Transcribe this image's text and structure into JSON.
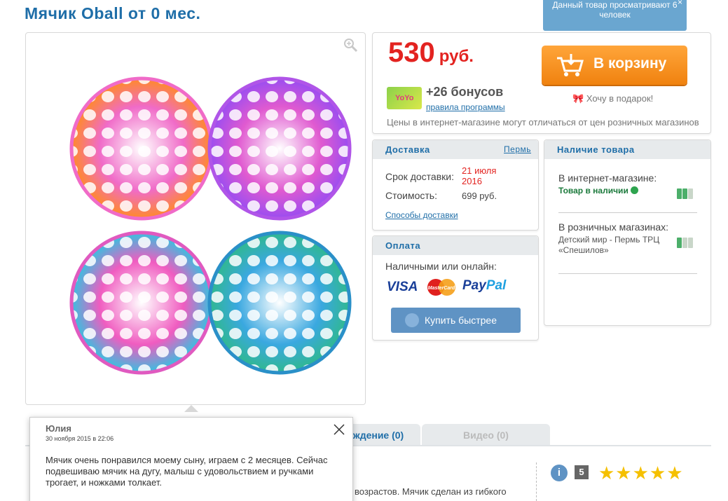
{
  "product": {
    "title": "Мячик Oball от 0 мес.",
    "viewers_text": "Данный товар просматривают 6 человек",
    "viewers_close": "×"
  },
  "price": {
    "value": "530",
    "currency": "руб.",
    "bonus": "+26 бонусов",
    "bonus_card_label": "YoYo",
    "bonus_link": "правила программы",
    "note": "Цены в интернет-магазине могут отличаться от цен розничных магазинов",
    "cart_button": "В корзину",
    "gift": "Хочу в подарок!"
  },
  "delivery": {
    "header": "Доставка",
    "city": "Пермь",
    "term_label": "Срок доставки:",
    "term_value": "21 июля 2016",
    "cost_label": "Стоимость:",
    "cost_value": "699 руб.",
    "methods_link": "Способы доставки"
  },
  "payment": {
    "header": "Оплата",
    "label": "Наличными или онлайн:",
    "visa": "VISA",
    "mastercard": "MasterCard",
    "paypal_a": "Pay",
    "paypal_b": "Pal",
    "quick_button": "Купить быстрее"
  },
  "stock": {
    "header": "Наличие товара",
    "online_label": "В интернет-магазине:",
    "online_value": "Товар в наличии",
    "online_level": 2,
    "retail_label": "В розничных магазинах:",
    "retail_value": "Детский мир - Пермь ТРЦ «Спешилов»",
    "retail_level": 1,
    "level_max": 3
  },
  "tabs": {
    "discussion": "ждение (0)",
    "video": "Видео (0)"
  },
  "description_fragment": "возрастов. Мячик сделан из гибкого",
  "rating": {
    "info": "i",
    "score": "5",
    "stars": "★★★★★"
  },
  "review": {
    "name": "Юлия",
    "date": "30 ноября 2015 в 22:06",
    "text": "Мячик очень понравился моему сыну, играем с 2 месяцев. Сейчас подвешиваю мячик на дугу, малыш с удовольствием и ручками трогает, и ножками толкает."
  },
  "colors": {
    "accent": "#1f6ea8",
    "price": "#e32320",
    "cart": "#f0820f",
    "stock_on": "#4caf6a",
    "stock_off": "#c9d6c9"
  }
}
